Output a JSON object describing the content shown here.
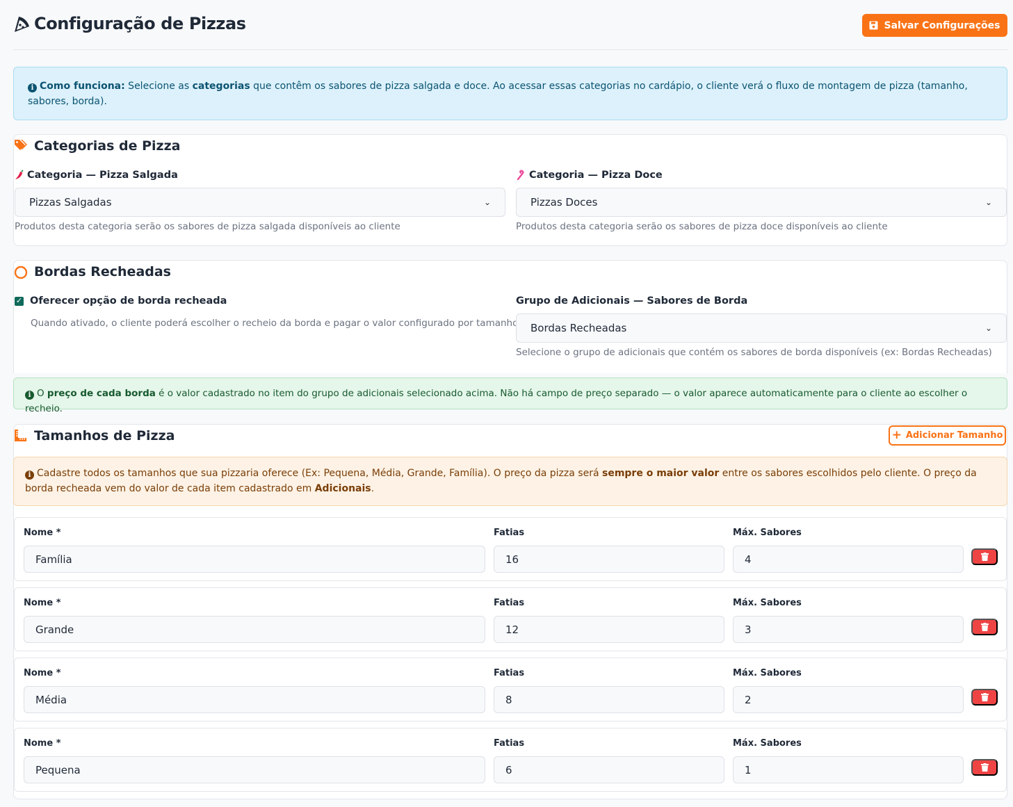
{
  "header": {
    "title": "Configuração de Pizzas",
    "save_label": "Salvar Configurações"
  },
  "info_alert": {
    "lead": "Como funciona:",
    "text1": " Selecione as ",
    "strong1": "categorias",
    "text2": " que contêm os sabores de pizza salgada e doce. Ao acessar essas categorias no cardápio, o cliente verá o fluxo de montagem de pizza (tamanho, sabores, borda)."
  },
  "categories": {
    "title": "Categorias de Pizza",
    "salgada": {
      "label": "Categoria — Pizza Salgada",
      "value": "Pizzas Salgadas",
      "help": "Produtos desta categoria serão os sabores de pizza salgada disponíveis ao cliente"
    },
    "doce": {
      "label": "Categoria — Pizza Doce",
      "value": "Pizzas Doces",
      "help": "Produtos desta categoria serão os sabores de pizza doce disponíveis ao cliente"
    }
  },
  "bordas": {
    "title": "Bordas Recheadas",
    "checkbox_label": "Oferecer opção de borda recheada",
    "checkbox_checked": true,
    "checkbox_help": "Quando ativado, o cliente poderá escolher o recheio da borda e pagar o valor configurado por tamanho",
    "group_label": "Grupo de Adicionais — Sabores de Borda",
    "group_value": "Bordas Recheadas",
    "group_help": "Selecione o grupo de adicionais que contém os sabores de borda disponíveis (ex: Bordas Recheadas)"
  },
  "success_alert": {
    "text1": "O ",
    "strong1": "preço de cada borda",
    "text2": " é o valor cadastrado no item do grupo de adicionais selecionado acima. Não há campo de preço separado — o valor aparece automaticamente para o cliente ao escolher o recheio."
  },
  "sizes": {
    "title": "Tamanhos de Pizza",
    "add_label": "Adicionar Tamanho",
    "warn": {
      "text1": "Cadastre todos os tamanhos que sua pizzaria oferece (Ex: Pequena, Média, Grande, Família). O preço da pizza será ",
      "strong1": "sempre o maior valor",
      "text2": " entre os sabores escolhidos pelo cliente. O preço da borda recheada vem do valor de cada item cadastrado em ",
      "strong2": "Adicionais",
      "text3": "."
    },
    "col_name": "Nome *",
    "col_slices": "Fatias",
    "col_flavors": "Máx. Sabores",
    "rows": [
      {
        "name": "Família",
        "slices": "16",
        "flavors": "4"
      },
      {
        "name": "Grande",
        "slices": "12",
        "flavors": "3"
      },
      {
        "name": "Média",
        "slices": "8",
        "flavors": "2"
      },
      {
        "name": "Pequena",
        "slices": "6",
        "flavors": "1"
      }
    ]
  },
  "colors": {
    "accent": "#f97316",
    "danger": "#ef4444",
    "check": "#0f6a5b"
  }
}
